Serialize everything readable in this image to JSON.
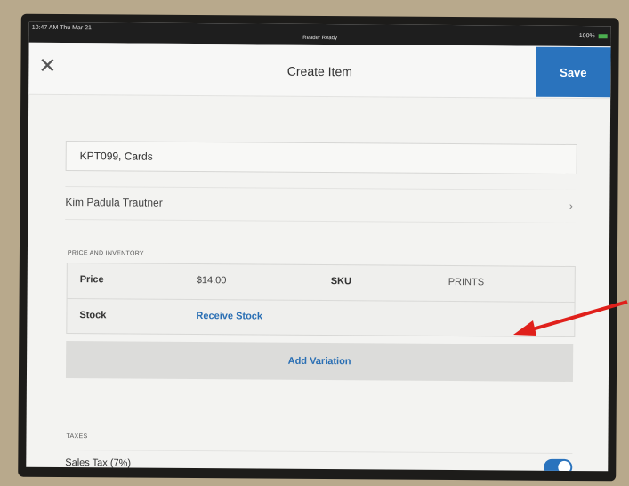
{
  "status_bar": {
    "time": "10:47 AM  Thu Mar 21",
    "center": "Reader Ready",
    "battery": "100%"
  },
  "header": {
    "close_icon": "close-icon",
    "title": "Create Item",
    "save_label": "Save"
  },
  "item": {
    "name": "KPT099, Cards",
    "category": "Kim Padula Trautner"
  },
  "price_inventory": {
    "section_label": "PRICE AND INVENTORY",
    "price_label": "Price",
    "price_value": "$14.00",
    "sku_label": "SKU",
    "sku_value": "PRINTS",
    "stock_label": "Stock",
    "stock_action": "Receive Stock",
    "add_variation": "Add Variation"
  },
  "taxes": {
    "section_label": "TAXES",
    "sales_tax_label": "Sales Tax (7%)",
    "sales_tax_enabled": true
  },
  "colors": {
    "accent": "#2a73bd",
    "arrow": "#e0201b"
  }
}
